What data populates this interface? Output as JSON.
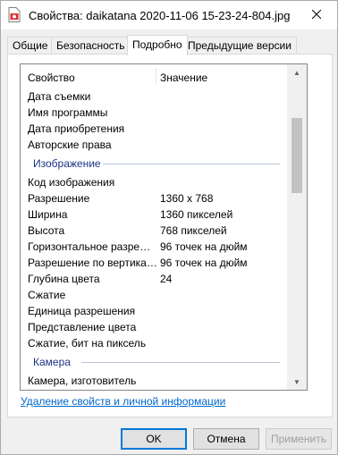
{
  "window": {
    "title": "Свойства: daikatana 2020-11-06 15-23-24-804.jpg",
    "icon": "jpg-file-icon",
    "close_icon": "close-icon"
  },
  "tabs": [
    {
      "label": "Общие"
    },
    {
      "label": "Безопасность"
    },
    {
      "label": "Подробно"
    },
    {
      "label": "Предыдущие версии"
    }
  ],
  "active_tab": "Подробно",
  "details": {
    "col_property": "Свойство",
    "col_value": "Значение",
    "rows_top": [
      {
        "property": "Дата съемки",
        "value": ""
      },
      {
        "property": "Имя программы",
        "value": ""
      },
      {
        "property": "Дата приобретения",
        "value": ""
      },
      {
        "property": "Авторские права",
        "value": ""
      }
    ],
    "group_image": "Изображение",
    "rows_image": [
      {
        "property": "Код изображения",
        "value": ""
      },
      {
        "property": "Разрешение",
        "value": "1360 x 768"
      },
      {
        "property": "Ширина",
        "value": "1360 пикселей"
      },
      {
        "property": "Высота",
        "value": "768 пикселей"
      },
      {
        "property": "Горизонтальное разрешение",
        "value": "96 точек на дюйм"
      },
      {
        "property": "Разрешение по вертикали",
        "value": "96 точек на дюйм"
      },
      {
        "property": "Глубина цвета",
        "value": "24"
      },
      {
        "property": "Сжатие",
        "value": ""
      },
      {
        "property": "Единица разрешения",
        "value": ""
      },
      {
        "property": "Представление цвета",
        "value": ""
      },
      {
        "property": "Сжатие, бит на пиксель",
        "value": ""
      }
    ],
    "group_camera": "Камера",
    "rows_camera": [
      {
        "property": "Камера, изготовитель",
        "value": ""
      }
    ]
  },
  "remove_link": "Удаление свойств и личной информации",
  "buttons": {
    "ok": "OK",
    "cancel": "Отмена",
    "apply": "Применить"
  },
  "colors": {
    "group_title": "#1e3287",
    "link": "#0066cc",
    "ok_border": "#0078d7"
  }
}
